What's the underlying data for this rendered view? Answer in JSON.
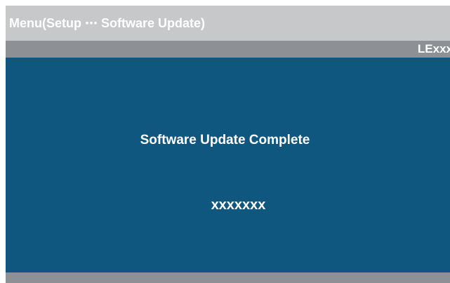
{
  "header": {
    "title": "Menu(Setup ⋯ Software Update)",
    "model": "LExxx"
  },
  "main": {
    "status_message": "Software Update Complete",
    "version": "xxxxxxx"
  },
  "colors": {
    "title_bar": "#c6c8ca",
    "model_bar": "#8d9195",
    "content_background": "#10577f",
    "text": "#ffffff"
  }
}
